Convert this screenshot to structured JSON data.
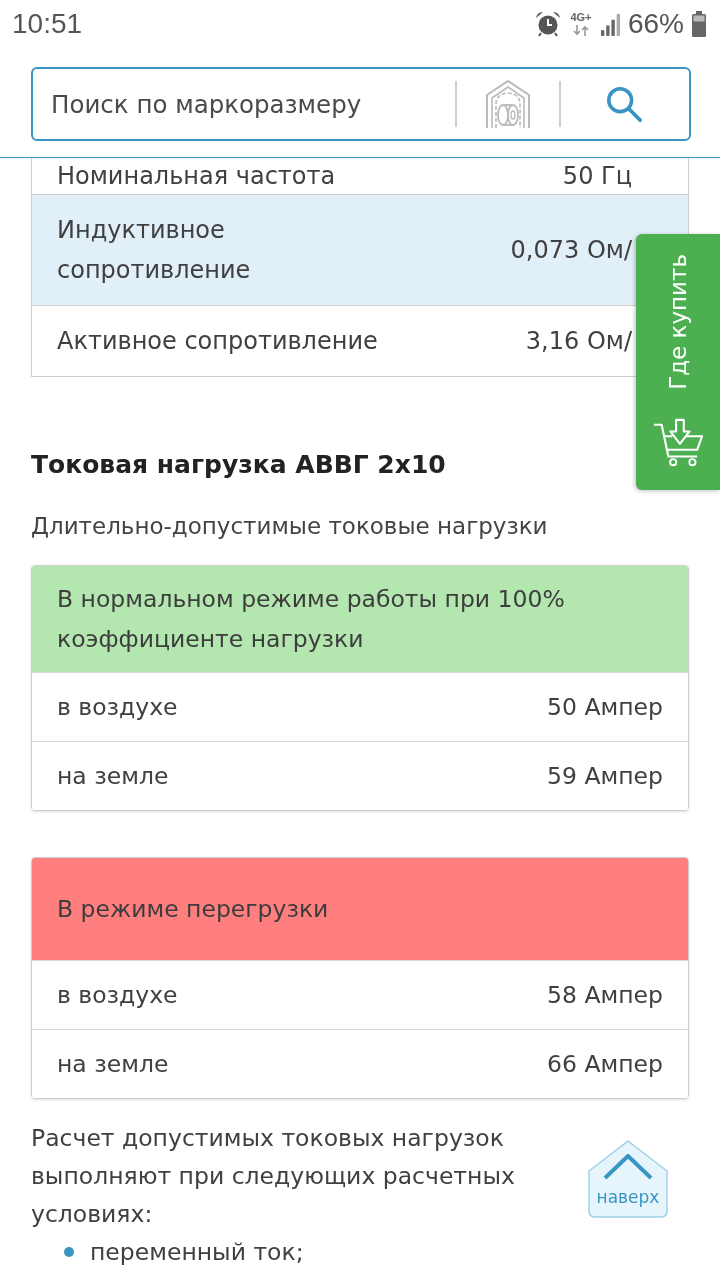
{
  "status_bar": {
    "time": "10:51",
    "network": "4G+",
    "battery": "66%"
  },
  "search": {
    "placeholder": "Поиск по маркоразмеру"
  },
  "spec_table": {
    "rows": [
      {
        "label": "Номинальная частота",
        "value": "50 Гц"
      },
      {
        "label": "Индуктивное сопротивление",
        "value": "0,073 Ом/"
      },
      {
        "label": "Активное сопротивление",
        "value": "3,16 Ом/"
      }
    ]
  },
  "side_tab": {
    "label": "Где купить"
  },
  "section": {
    "title": "Токовая нагрузка АВВГ 2х10",
    "subtitle": "Длительно-допустимые токовые нагрузки"
  },
  "load_tables": [
    {
      "header": "В нормальном режиме работы при 100% коэффициенте нагрузки",
      "color": "#b4e6b0",
      "rows": [
        {
          "label": "в воздухе",
          "value": "50 Ампер"
        },
        {
          "label": "на земле",
          "value": "59 Ампер"
        }
      ]
    },
    {
      "header": "В режиме перегрузки",
      "color": "#ff7f7f",
      "rows": [
        {
          "label": "в воздухе",
          "value": "58 Ампер"
        },
        {
          "label": "на земле",
          "value": "66 Ампер"
        }
      ]
    }
  ],
  "paragraph": "Расчет допустимых токовых нагрузок выполняют при следующих расчетных условиях:",
  "bullets": [
    "переменный ток;"
  ],
  "back_to_top": {
    "label": "наверх"
  }
}
